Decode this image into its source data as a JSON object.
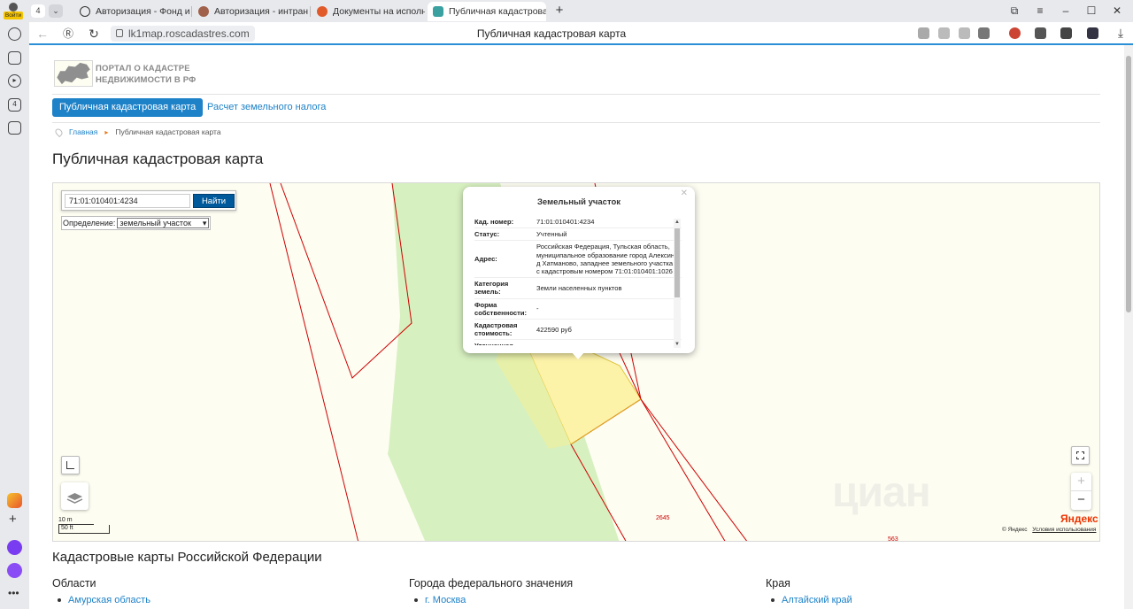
{
  "browser": {
    "profile_badge": "Войти",
    "tab_count": "4",
    "tabs": [
      {
        "title": "Авторизация - Фонд иму",
        "icon_color": "#333333"
      },
      {
        "title": "Авторизация - интранет",
        "icon_color": "#a0604a"
      },
      {
        "title": "Документы на исполнен",
        "icon_color": "#e05a2a"
      },
      {
        "title": "Публичная кадастрова",
        "icon_color": "#3aa0a0"
      }
    ],
    "address": "lk1map.roscadastres.com",
    "page_title": "Публичная кадастровая карта",
    "sidebar_badge": "4"
  },
  "site": {
    "logo_line1": "ПОРТАЛ О КАДАСТРЕ",
    "logo_line2": "НЕДВИЖИМОСТИ В РФ",
    "nav": {
      "active": "Публичная кадастровая карта",
      "tax": "Расчет земельного налога"
    },
    "breadcrumb": {
      "home": "Главная",
      "current": "Публичная кадастровая карта"
    },
    "heading": "Публичная кадастровая карта"
  },
  "map": {
    "search_value": "71:01:010401:4234",
    "search_button": "Найти",
    "definition_label": "Определение:",
    "definition_value": "земельный участок",
    "scale_m": "10 m",
    "scale_ft": "50 ft",
    "parcel_label_1": "2645",
    "parcel_label_2": "563",
    "yandex_logo_main": "Яндекс",
    "copyright": "© Яндекс",
    "terms": "Условия использования",
    "watermark": "циан"
  },
  "popup": {
    "title": "Земельный участок",
    "rows": [
      {
        "key": "Кад. номер:",
        "value": "71:01:010401:4234"
      },
      {
        "key": "Статус:",
        "value": "Учтенный"
      },
      {
        "key": "Адрес:",
        "value": "Российская Федерация, Тульская область, муниципальное образование город Алексин, д Хатманово, западнее земельного участка с кадастровым номером 71:01:010401:1026"
      },
      {
        "key": "Категория земель:",
        "value": "Земли населенных пунктов"
      },
      {
        "key": "Форма собственности:",
        "value": "-"
      },
      {
        "key": "Кадастровая стоимость:",
        "value": "422590 руб"
      },
      {
        "key": "Уточненная",
        "value": ""
      }
    ]
  },
  "regions": {
    "heading": "Кадастровые карты Российской Федерации",
    "col1": {
      "title": "Области",
      "item": "Амурская область"
    },
    "col2": {
      "title": "Города федерального значения",
      "item": "г. Москва"
    },
    "col3": {
      "title": "Края",
      "item": "Алтайский край"
    }
  },
  "colors": {
    "accent": "#1e82c8",
    "button_dark": "#00599b",
    "parcel_line": "#d00000",
    "green_zone": "#d7f0c0",
    "selected_parcel": "#fdf3a8"
  }
}
